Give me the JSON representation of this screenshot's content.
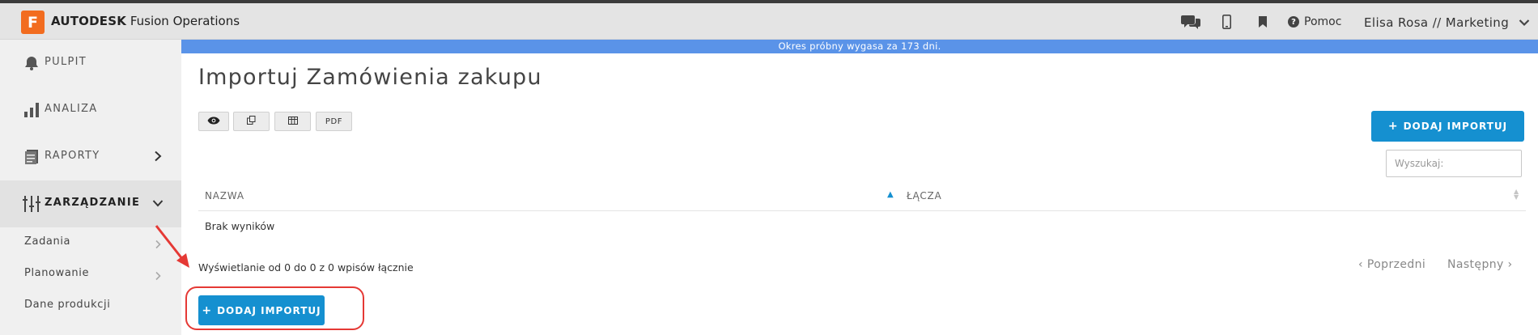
{
  "header": {
    "logo_letter": "F",
    "brand_bold": "AUTODESK",
    "brand_rest": " Fusion Operations",
    "help_label": "Pomoc",
    "user_label": "Elisa Rosa // Marketing",
    "icons": [
      "chat-icon",
      "mobile-icon",
      "bookmark-icon",
      "help-icon",
      "chevron-down-icon"
    ]
  },
  "sidebar": {
    "items": [
      {
        "label": "PULPIT",
        "icon": "bell-icon"
      },
      {
        "label": "ANALIZA",
        "icon": "bar-chart-icon"
      },
      {
        "label": "RAPORTY",
        "icon": "report-icon"
      },
      {
        "label": "ZARZĄDZANIE",
        "icon": "sliders-icon"
      }
    ],
    "subitems": [
      {
        "label": "Zadania"
      },
      {
        "label": "Planowanie"
      },
      {
        "label": "Dane produkcji"
      }
    ]
  },
  "banner": {
    "text": "Okres próbny wygasa za 173 dni."
  },
  "main": {
    "title": "Importuj Zamówienia zakupu",
    "toolbar": {
      "pdf_label": "PDF"
    },
    "add_import_label": "DODAJ IMPORTUJ",
    "search_placeholder": "Wyszukaj:",
    "table": {
      "columns": [
        "NAZWA",
        "ŁĄCZA"
      ],
      "empty_text": "Brak wyników"
    },
    "info_text": "Wyświetlanie od 0 do 0 z 0 wpisów łącznie",
    "pager": {
      "prev_label": "Poprzedni",
      "next_label": "Następny"
    }
  },
  "colors": {
    "accent": "#1590d0",
    "banner": "#5a93e8",
    "logo": "#f26c1f",
    "annotation": "#e53935"
  }
}
